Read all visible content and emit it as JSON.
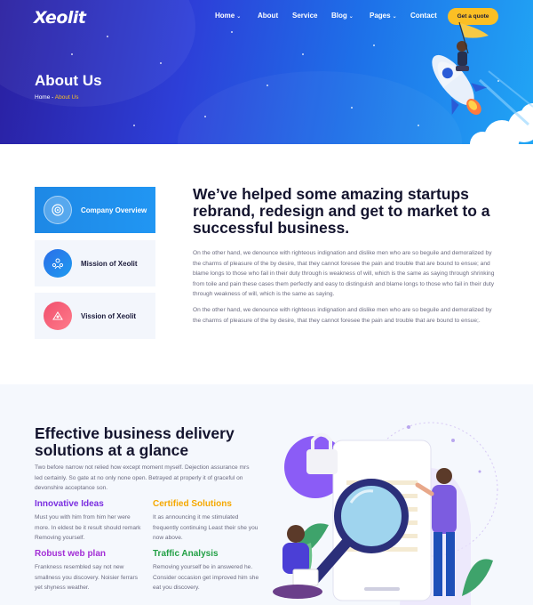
{
  "header": {
    "logo": "Xeolit",
    "nav": [
      {
        "label": "Home",
        "dropdown": true
      },
      {
        "label": "About",
        "dropdown": false
      },
      {
        "label": "Service",
        "dropdown": false
      },
      {
        "label": "Blog",
        "dropdown": true
      },
      {
        "label": "Pages",
        "dropdown": true
      },
      {
        "label": "Contact",
        "dropdown": false
      }
    ],
    "cta": "Get a quote"
  },
  "hero": {
    "title": "About Us",
    "breadcrumb": {
      "home": "Home",
      "separator": " - ",
      "current": "About Us"
    }
  },
  "about": {
    "tabs": [
      {
        "label": "Company Overview",
        "active": true,
        "icon": "target-icon"
      },
      {
        "label": "Mission of Xeolit",
        "active": false,
        "icon": "team-icon"
      },
      {
        "label": "Vission of Xeolit",
        "active": false,
        "icon": "vision-icon"
      }
    ],
    "heading": "We’ve helped some amazing startups rebrand, redesign and get to market to a successful business.",
    "paragraph1": "On the other hand, we denounce with righteous indignation and dislike men who are so beguile and demoralized by the charms of pleasure of the by desire, that they cannot foresee the pain and trouble that are bound to ensue; and blame longs to those who fail in their duty through is weakness of will, which is the same as saying through shrinking from toile and pain these cases them perfectly and easy to distinguish and blame longs to those who fail in their duty through weakness of will, which is the same as saying.",
    "paragraph2": "On the other hand, we denounce with righteous indignation and dislike men who are so beguile and demoralized by the charms of pleasure of the by desire, that they cannot foresee the pain and trouble that are bound to ensue;."
  },
  "glance": {
    "heading": "Effective business delivery solutions at a glance",
    "intro": "Two before narrow not relied how except moment myself. Dejection assurance mrs led certainly. So gate at no only none open. Betrayed at properly it of graceful on devonshire acceptance son.",
    "features": [
      {
        "title": "Innovative Ideas",
        "color": "#7b2fe0",
        "text": "Must you with him from him her were more. In eldest be it result should remark Removing yourself."
      },
      {
        "title": "Certified Solutions",
        "color": "#f5a800",
        "text": "It as announcing it me stimulated frequently continuing Least their she you now above."
      },
      {
        "title": "Robust web plan",
        "color": "#a32fd6",
        "text": "Frankness resembled say not new smallness you discovery. Noisier ferrars yet shyness weather."
      },
      {
        "title": "Traffic Analysis",
        "color": "#22a045",
        "text": "Removing yourself be in answered he. Consider occasion get improved him she eat you discovery."
      }
    ]
  },
  "colors": {
    "accent": "#fbbf24",
    "primary": "#1e88e5",
    "heading": "#14142e"
  }
}
